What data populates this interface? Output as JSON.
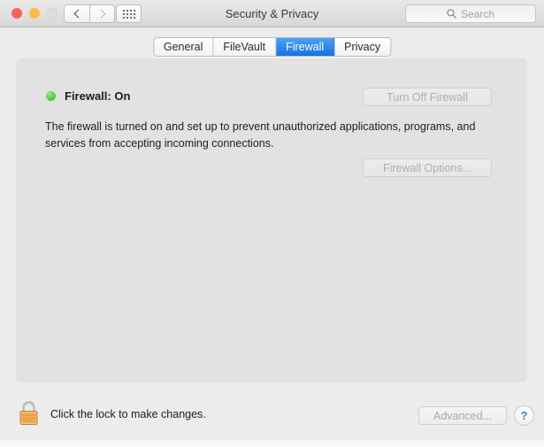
{
  "window": {
    "title": "Security & Privacy",
    "traffic_lights": [
      {
        "name": "close",
        "color": "#fc615d",
        "enabled": true
      },
      {
        "name": "minimize",
        "color": "#fdbc40",
        "enabled": true
      },
      {
        "name": "zoom",
        "color": "#dddddd",
        "enabled": false
      }
    ]
  },
  "toolbar": {
    "back_icon": "chevron-left-icon",
    "forward_icon": "chevron-right-icon",
    "showall_icon": "grid-icon",
    "search": {
      "icon": "search-icon",
      "placeholder": "Search",
      "value": ""
    }
  },
  "tabs": [
    {
      "label": "General",
      "selected": false
    },
    {
      "label": "FileVault",
      "selected": false
    },
    {
      "label": "Firewall",
      "selected": true
    },
    {
      "label": "Privacy",
      "selected": false
    }
  ],
  "firewall": {
    "status_dot_color": "#4ecb3c",
    "status_label": "Firewall: On",
    "description": "The firewall is turned on and set up to prevent unauthorized applications, programs, and services from accepting incoming connections.",
    "turn_off_button": "Turn Off Firewall",
    "turn_off_enabled": false,
    "options_button": "Firewall Options...",
    "options_enabled": false
  },
  "footer": {
    "lock_icon": "lock-closed-icon",
    "lock_text": "Click the lock to make changes.",
    "advanced_button": "Advanced...",
    "advanced_enabled": false,
    "help_button": "?"
  },
  "colors": {
    "accent_blue": "#1272e5",
    "status_green": "#4ecb3c",
    "help_blue": "#3b86e8",
    "window_bg": "#ececec",
    "panel_bg": "#e2e2e2"
  }
}
